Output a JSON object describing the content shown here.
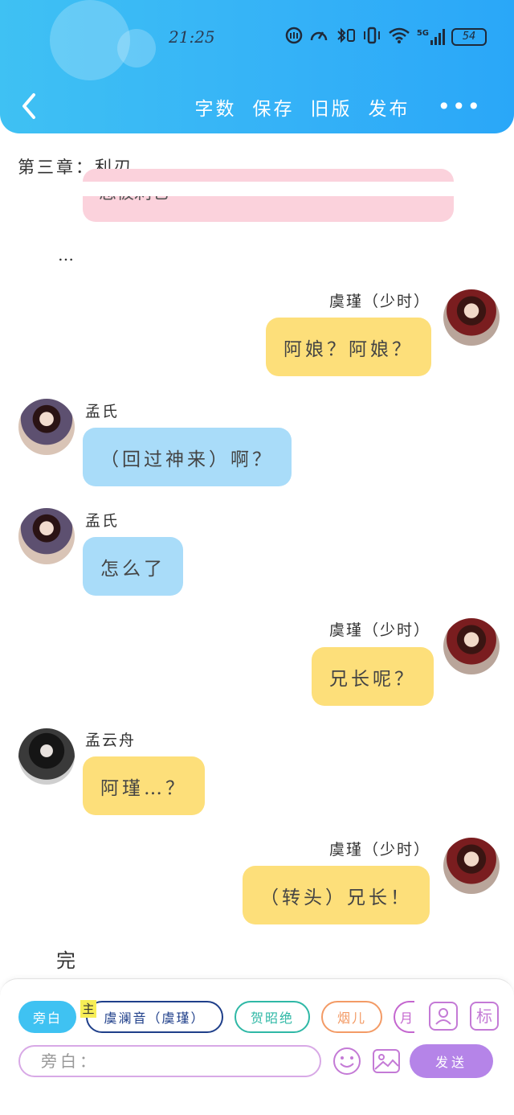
{
  "status_bar": {
    "time": "21:25",
    "network": "5G",
    "battery": "54"
  },
  "toolbar": {
    "word_count": "字数",
    "save": "保存",
    "old_version": "旧版",
    "publish": "发布",
    "more": "•••"
  },
  "chapter_title": "第三章：利刃",
  "partial_bubble_text": "您被刺它",
  "ellipsis": "…",
  "messages": [
    {
      "speaker": "虞瑾（少时）",
      "text": "阿娘？阿娘？",
      "side": "right",
      "color": "yellow"
    },
    {
      "speaker": "孟氏",
      "text": "（回过神来）啊？",
      "side": "left",
      "color": "blue"
    },
    {
      "speaker": "孟氏",
      "text": "怎么了",
      "side": "left",
      "color": "blue"
    },
    {
      "speaker": "虞瑾（少时）",
      "text": "兄长呢？",
      "side": "right",
      "color": "yellow"
    },
    {
      "speaker": "孟云舟",
      "text": "阿瑾…？",
      "side": "left",
      "color": "yellow"
    },
    {
      "speaker": "虞瑾（少时）",
      "text": "（转头）兄长！",
      "side": "right",
      "color": "yellow"
    }
  ],
  "end_text": "完",
  "characters": {
    "aside": "旁白",
    "main_badge": "主",
    "yu": "虞澜音（虞瑾）",
    "he": "贺昭绝",
    "yan": "烟儿",
    "partial": "月"
  },
  "tag_icon_label": "标",
  "input": {
    "placeholder": "旁白："
  },
  "send_label": "发送",
  "colors": {
    "header": "#35b2f7",
    "yellow_bubble": "#fddf7a",
    "blue_bubble": "#a9dcf9",
    "pink_bubble": "#fbd2dc",
    "send": "#b584e8"
  }
}
